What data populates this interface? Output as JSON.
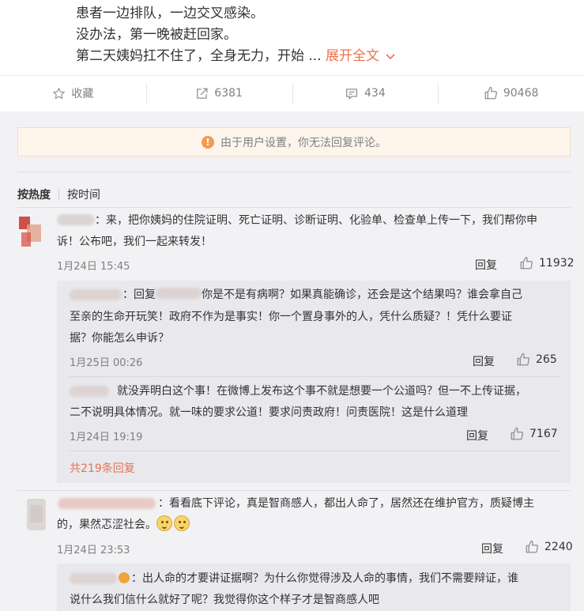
{
  "post": {
    "line1": "患者一边排队，一边交叉感染。",
    "line2": "没办法，第一晚被赶回家。",
    "line3": "第二天姨妈扛不住了，全身无力，开始 ...",
    "expand_label": "展开全文",
    "expand_icon": "chevron-down-icon"
  },
  "actions": {
    "favorite_label": "收藏",
    "repost_count": "6381",
    "comment_count": "434",
    "like_count": "90468"
  },
  "notice": {
    "text": "由于用户设置，你无法回复评论。",
    "icon": "warning-icon",
    "icon_glyph": "!"
  },
  "sort": {
    "by_hot": "按热度",
    "by_time": "按时间"
  },
  "comments": [
    {
      "text_line1": "：来，把你姨妈的住院证明、死亡证明、诊断证明、化验单、检查单上传一下，我们帮你申",
      "text_line2": "诉！公布吧，我们一起来转发！",
      "time": "1月24日 15:45",
      "reply_label": "回复",
      "likes": "11932",
      "replies": [
        {
          "prefix": "：回复",
          "text_line1": "你是不是有病啊？如果真能确诊，还会是这个结果吗？谁会拿自己",
          "text_line2": "至亲的生命开玩笑！政府不作为是事实！你一个置身事外的人，凭什么质疑？！凭什么要证",
          "text_line3": "据？你能怎么申诉？",
          "time": "1月25日 00:26",
          "reply_label": "回复",
          "likes": "265"
        },
        {
          "text_line1": "就没弄明白这个事！在微博上发布这个事不就是想要一个公道吗？但一不上传证据，",
          "text_line2": "二不说明具体情况。就一味的要求公道！要求问责政府！问责医院！这是什么道理",
          "time": "1月24日 19:19",
          "reply_label": "回复",
          "likes": "7167"
        }
      ],
      "more_replies": "共219条回复"
    },
    {
      "text_line1": "：看看底下评论，真是智商感人，都出人命了，居然还在维护官方，质疑博主",
      "text_line2": "的，果然忑涩社会。",
      "time": "1月24日 23:53",
      "reply_label": "回复",
      "likes": "2240",
      "replies": [
        {
          "text_line1": "：出人命的才要讲证据啊？为什么你觉得涉及人命的事情，我们不需要辩证，谁",
          "text_line2": "说什么我们信什么就好了呢？我觉得你这个样子才是智商感人吧"
        }
      ]
    }
  ],
  "colors": {
    "accent": "#eb7350",
    "muted": "#808080",
    "panel": "#f2f2f5",
    "sub_panel": "#e8e8ed"
  }
}
